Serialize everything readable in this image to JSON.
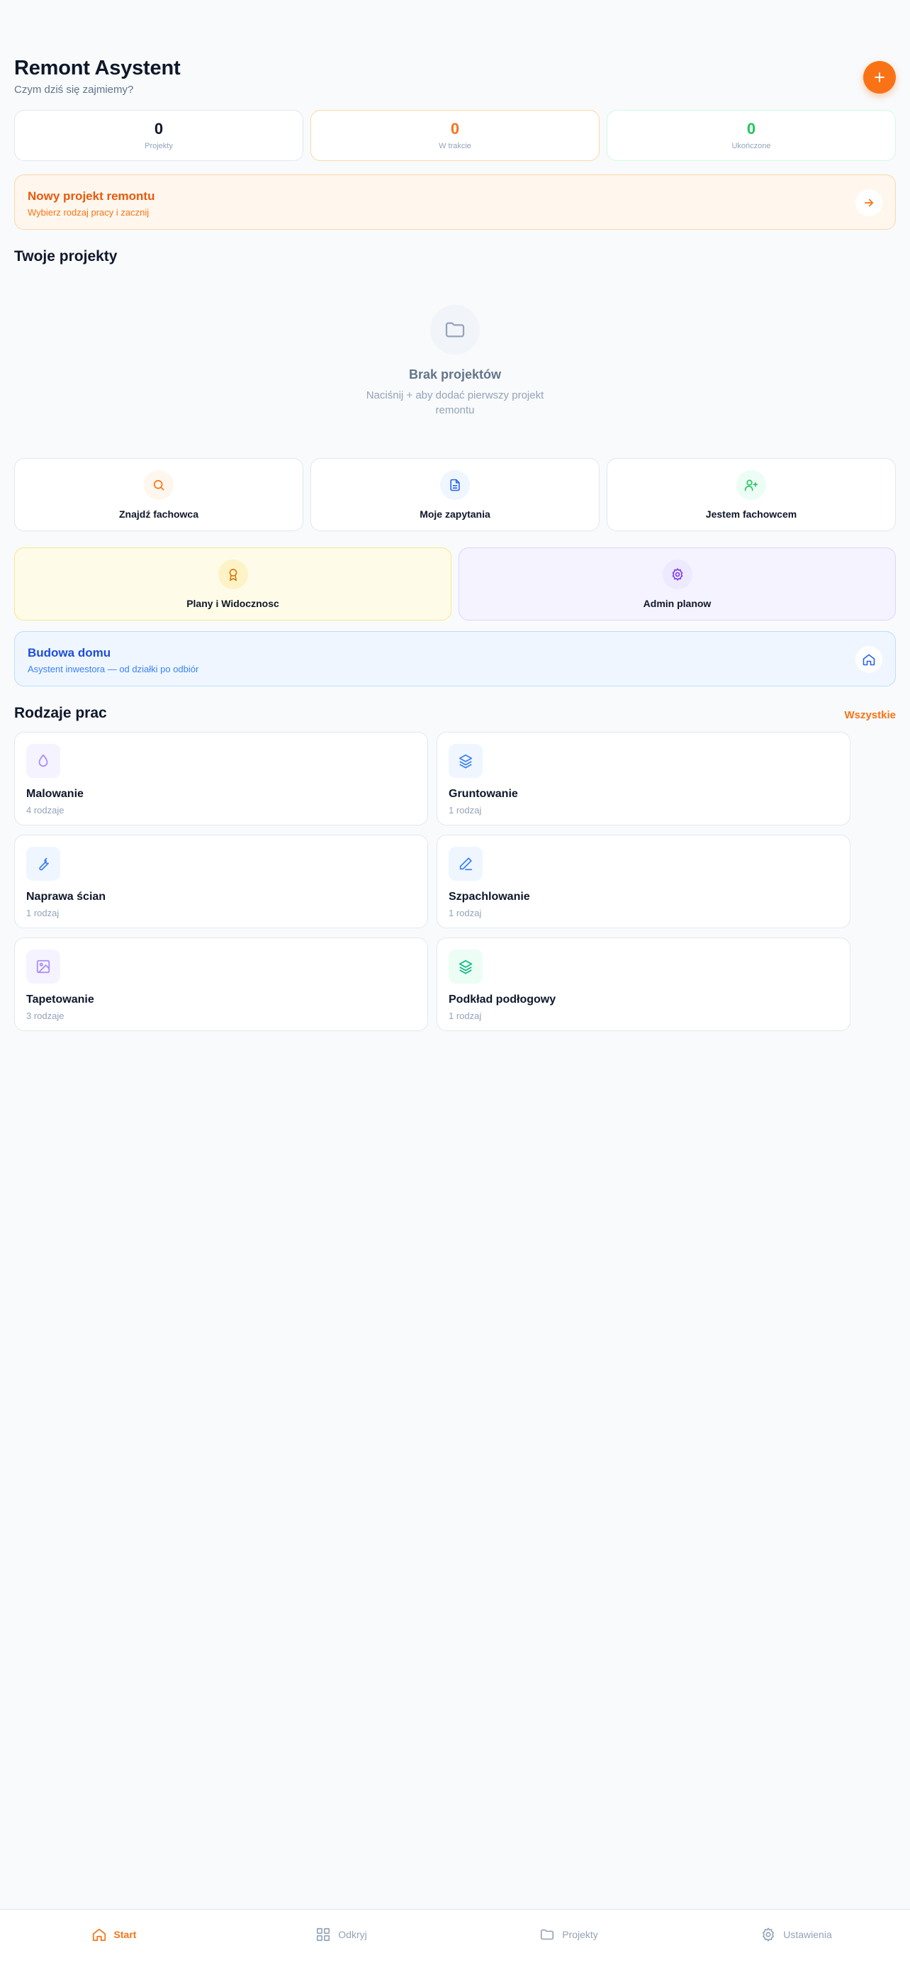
{
  "header": {
    "title": "Remont Asystent",
    "subtitle": "Czym dziś się zajmiemy?",
    "add_icon": "plus-icon"
  },
  "stats": [
    {
      "value": "0",
      "label": "Projekty",
      "color": "#0f172a"
    },
    {
      "value": "0",
      "label": "W trakcie",
      "color": "#f97316"
    },
    {
      "value": "0",
      "label": "Ukończone",
      "color": "#22c55e"
    }
  ],
  "new_project_banner": {
    "title": "Nowy projekt remontu",
    "subtitle": "Wybierz rodzaj pracy i zacznij",
    "icon": "arrow-right-icon"
  },
  "projects": {
    "title": "Twoje projekty",
    "empty_title": "Brak projektów",
    "empty_subtitle": "Naciśnij + aby dodać pierwszy projekt remontu",
    "empty_icon": "folder-icon"
  },
  "actions": [
    {
      "label": "Znajdź fachowca",
      "icon": "search-icon"
    },
    {
      "label": "Moje zapytania",
      "icon": "document-icon"
    },
    {
      "label": "Jestem fachowcem",
      "icon": "user-plus-icon"
    }
  ],
  "actions2": [
    {
      "label": "Plany i Widocznosc",
      "icon": "award-icon"
    },
    {
      "label": "Admin planow",
      "icon": "gear-icon"
    }
  ],
  "budowa": {
    "title": "Budowa domu",
    "subtitle": "Asystent inwestora — od działki po odbiór",
    "icon": "home-icon"
  },
  "work_types": {
    "title": "Rodzaje prac",
    "see_all": "Wszystkie",
    "items": [
      {
        "name": "Malowanie",
        "count": "4 rodzaje",
        "icon": "droplet-icon"
      },
      {
        "name": "Gruntowanie",
        "count": "1 rodzaj",
        "icon": "layers-icon"
      },
      {
        "name": "Naprawa ścian",
        "count": "1 rodzaj",
        "icon": "wrench-icon"
      },
      {
        "name": "Szpachlowanie",
        "count": "1 rodzaj",
        "icon": "pen-icon"
      },
      {
        "name": "Tapetowanie",
        "count": "3 rodzaje",
        "icon": "image-icon"
      },
      {
        "name": "Podkład podłogowy",
        "count": "1 rodzaj",
        "icon": "layers-icon"
      }
    ]
  },
  "nav": [
    {
      "label": "Start",
      "icon": "home-icon",
      "active": true
    },
    {
      "label": "Odkryj",
      "icon": "grid-icon",
      "active": false
    },
    {
      "label": "Projekty",
      "icon": "folder-icon",
      "active": false
    },
    {
      "label": "Ustawienia",
      "icon": "gear-icon",
      "active": false
    }
  ],
  "colors": {
    "accent": "#f97316",
    "success": "#22c55e",
    "info": "#2563eb",
    "background": "#f8fafc"
  }
}
